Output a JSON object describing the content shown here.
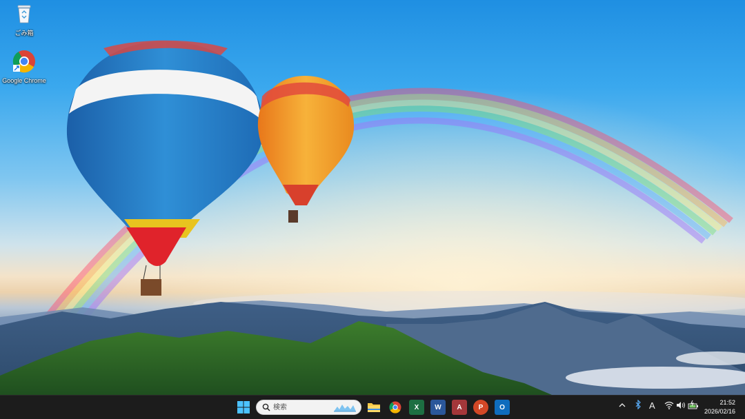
{
  "desktop": {
    "icons": [
      {
        "label": "ごみ箱",
        "icon": "recycle-bin-icon"
      },
      {
        "label": "Google Chrome",
        "icon": "chrome-icon"
      }
    ]
  },
  "taskbar": {
    "search": {
      "placeholder": "検索"
    },
    "apps": [
      {
        "icon": "windows-start-icon"
      },
      {
        "icon": "file-explorer-icon"
      },
      {
        "icon": "chrome-icon"
      },
      {
        "icon": "excel-icon",
        "letter": "X"
      },
      {
        "icon": "word-icon",
        "letter": "W"
      },
      {
        "icon": "access-icon",
        "letter": "A"
      },
      {
        "icon": "powerpoint-icon",
        "letter": "P"
      },
      {
        "icon": "outlook-icon",
        "letter": "O"
      }
    ],
    "tray": {
      "ime": "A"
    },
    "clock": {
      "time": "21:52",
      "date": "2026/02/16"
    }
  },
  "colors": {
    "taskbar_bg": "#1c1c1c",
    "excel": "#1d6f42",
    "word": "#2b579a",
    "access": "#a4373a",
    "powerpoint": "#d24726",
    "outlook": "#0f6cbd"
  }
}
